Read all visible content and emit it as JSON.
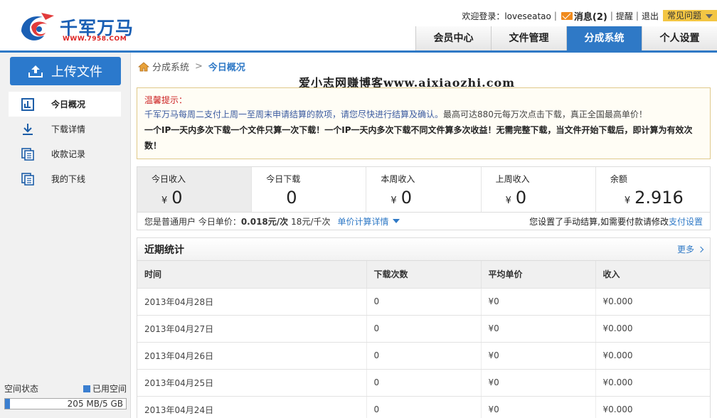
{
  "header": {
    "logo_text": "千军万马",
    "logo_url": "WWW.7958.COM",
    "welcome": "欢迎登录：loveseatao",
    "messages": "消息(2)",
    "remind": "提醒",
    "logout": "退出",
    "faq": "常见问题",
    "nav": [
      {
        "label": "会员中心"
      },
      {
        "label": "文件管理"
      },
      {
        "label": "分成系统"
      },
      {
        "label": "个人设置"
      }
    ],
    "accent": "#2f79c6"
  },
  "sidebar": {
    "upload_label": "上传文件",
    "items": [
      {
        "label": "今日概况",
        "icon": "dashboard-icon"
      },
      {
        "label": "下载详情",
        "icon": "download-icon"
      },
      {
        "label": "收款记录",
        "icon": "record-icon"
      },
      {
        "label": "我的下线",
        "icon": "downline-icon"
      }
    ],
    "space_label": "空间状态",
    "used_label": "已用空间",
    "space_value": "205 MB/5 GB",
    "space_used_fraction": 0.04
  },
  "breadcrumb": {
    "root": "分成系统",
    "current": "今日概况"
  },
  "watermark": "爱小志网赚博客www.aixiaozhi.com",
  "notice": {
    "title": "温馨提示：",
    "line1": "千军万马每周二支付上周一至周末申请结算的款项，请您尽快进行结算及确认。",
    "line1b": "最高可达880元每万次点击下载，真正全国最高单价！",
    "line2": "一个IP一天内多次下载一个文件只算一次下载！一个IP一天内多次下载不同文件算多次收益！无需完整下载，当文件开始下载后，即计算为有效次数！"
  },
  "stats": [
    {
      "label": "今日收入",
      "currency": "¥",
      "value": "0"
    },
    {
      "label": "今日下载",
      "currency": "",
      "value": "0"
    },
    {
      "label": "本周收入",
      "currency": "¥",
      "value": "0"
    },
    {
      "label": "上周收入",
      "currency": "¥",
      "value": "0"
    },
    {
      "label": "余额",
      "currency": "¥",
      "value": "2.916"
    }
  ],
  "infobar": {
    "prefix": "您是普通用户 今日单价：",
    "price_per": "0.018元/次",
    "price_k": "18元/千次",
    "detail_link": "单价计算详情",
    "right_text": "您设置了手动结算,如需要付款请修改",
    "right_link": "支付设置"
  },
  "recent": {
    "title": "近期统计",
    "more": "更多",
    "columns": [
      "时间",
      "下载次数",
      "平均单价",
      "收入"
    ],
    "rows": [
      [
        "2013年04月28日",
        "0",
        "¥0",
        "¥0.000"
      ],
      [
        "2013年04月27日",
        "0",
        "¥0",
        "¥0.000"
      ],
      [
        "2013年04月26日",
        "0",
        "¥0",
        "¥0.000"
      ],
      [
        "2013年04月25日",
        "0",
        "¥0",
        "¥0.000"
      ],
      [
        "2013年04月24日",
        "0",
        "¥0",
        "¥0.000"
      ]
    ]
  }
}
